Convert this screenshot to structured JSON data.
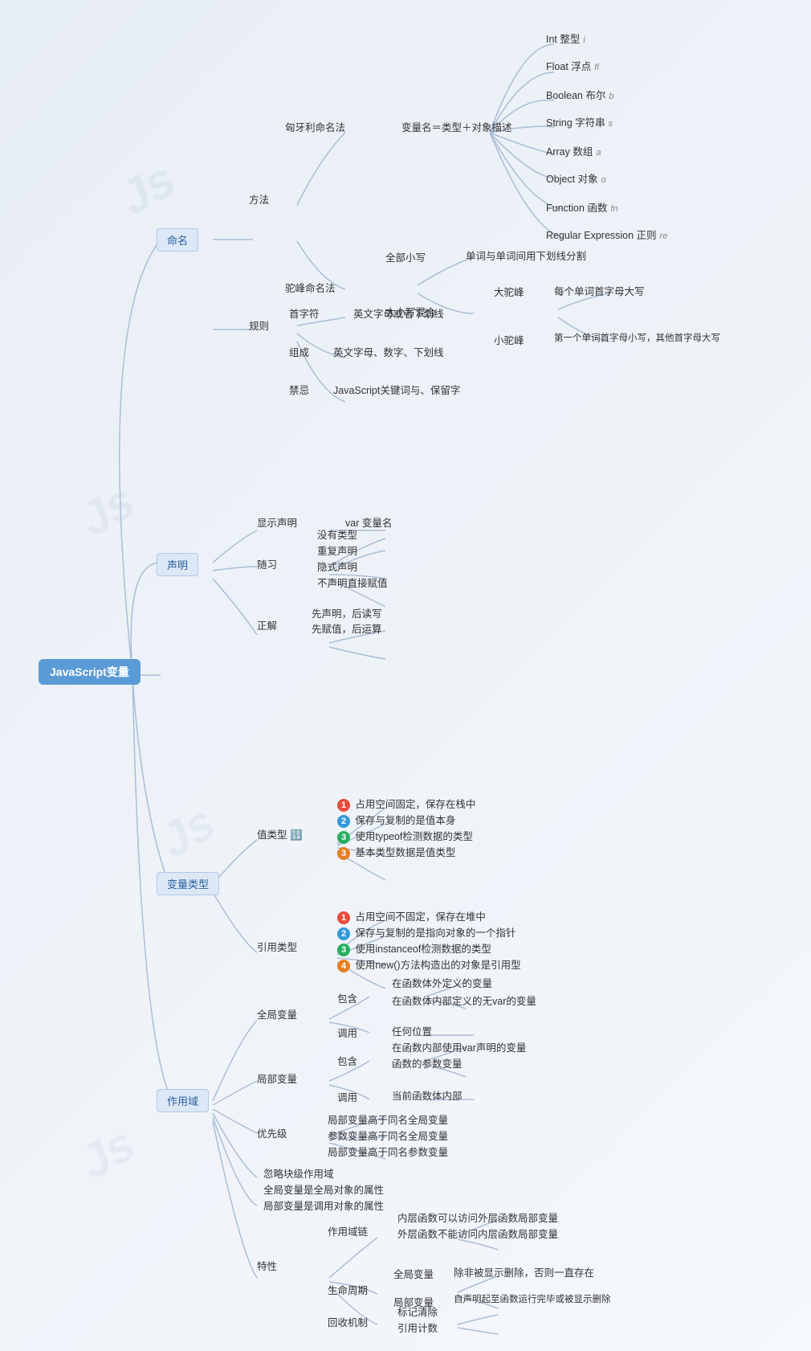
{
  "root": {
    "label": "JavaScript变量"
  },
  "sections": {
    "naming": {
      "label": "命名",
      "sub": {
        "method": {
          "label": "方法",
          "items": [
            {
              "label": "匈牙利命名法",
              "detail": "变量名＝类型＋对象描述",
              "types": [
                {
                  "name": "Int 整型",
                  "abbr": "i"
                },
                {
                  "name": "Float 浮点",
                  "abbr": "fl"
                },
                {
                  "name": "Boolean 布尔",
                  "abbr": "b"
                },
                {
                  "name": "String 字符串",
                  "abbr": "s"
                },
                {
                  "name": "Array 数组",
                  "abbr": "a"
                },
                {
                  "name": "Object 对象",
                  "abbr": "o"
                },
                {
                  "name": "Function 函数",
                  "abbr": "fn"
                },
                {
                  "name": "Regular Expression 正则",
                  "abbr": "re"
                }
              ]
            },
            {
              "label": "驼峰命名法",
              "items": [
                {
                  "label": "全部小写",
                  "detail": "单词与单词间用下划线分割"
                },
                {
                  "label": "大小写混合",
                  "items": [
                    {
                      "label": "大驼峰",
                      "detail": "每个单词首字母大写"
                    },
                    {
                      "label": "小驼峰",
                      "detail": "第一个单词首字母小写，其他首字母大写"
                    }
                  ]
                }
              ]
            }
          ]
        },
        "rules": {
          "label": "规则",
          "items": [
            {
              "label": "首字符",
              "detail": "英文字母或者下划线"
            },
            {
              "label": "组成",
              "detail": "英文字母、数字、下划线"
            },
            {
              "label": "禁忌",
              "detail": "JavaScript关键词与、保留字"
            }
          ]
        }
      }
    },
    "declaration": {
      "label": "声明",
      "sub": {
        "explicit": {
          "label": "显示声明",
          "detail": "var 变量名"
        },
        "implicit": {
          "label": "随习",
          "items": [
            {
              "text": "没有类型"
            },
            {
              "text": "重复声明"
            },
            {
              "text": "隐式声明"
            },
            {
              "text": "不声明直接赋值"
            }
          ]
        },
        "correct": {
          "label": "正解",
          "items": [
            {
              "text": "先声明，后读写"
            },
            {
              "text": "先赋值，后运算"
            }
          ]
        }
      }
    },
    "vartype": {
      "label": "变量类型",
      "sub": {
        "value": {
          "label": "值类型 🔢",
          "items": [
            {
              "badge": "red",
              "num": "1",
              "text": "占用空间固定，保存在栈中"
            },
            {
              "badge": "blue",
              "num": "2",
              "text": "保存与复制的是值本身"
            },
            {
              "badge": "green",
              "num": "3",
              "text": "使用typeof检测数据的类型"
            },
            {
              "badge": "orange",
              "num": "3",
              "text": "基本类型数据是值类型"
            }
          ]
        },
        "reference": {
          "label": "引用类型",
          "items": [
            {
              "badge": "red",
              "num": "1",
              "text": "占用空间不固定，保存在堆中"
            },
            {
              "badge": "blue",
              "num": "2",
              "text": "保存与复制的是指向对象的一个指针"
            },
            {
              "badge": "green",
              "num": "3",
              "text": "使用instanceof检测数据的类型"
            },
            {
              "badge": "orange",
              "num": "4",
              "text": "使用new()方法构造出的对象是引用型"
            }
          ]
        }
      }
    },
    "scope": {
      "label": "作用域",
      "sub": {
        "global": {
          "label": "全局变量",
          "items": [
            {
              "label": "包含",
              "items": [
                {
                  "text": "在函数体外定义的变量"
                },
                {
                  "text": "在函数体内部定义的无var的变量"
                }
              ]
            },
            {
              "label": "调用",
              "detail": "任何位置"
            }
          ]
        },
        "local": {
          "label": "局部变量",
          "items": [
            {
              "label": "包含",
              "items": [
                {
                  "text": "在函数内部使用var声明的变量"
                },
                {
                  "text": "函数的参数变量"
                }
              ]
            },
            {
              "label": "调用",
              "detail": "当前函数体内部"
            }
          ]
        },
        "priority": {
          "label": "优先级",
          "items": [
            {
              "text": "局部变量高于同名全局变量"
            },
            {
              "text": "参数变量高于同名全局变量"
            },
            {
              "text": "局部变量高于同名参数变量"
            }
          ]
        },
        "extra": [
          {
            "text": "忽略块级作用域"
          },
          {
            "text": "全局变量是全局对象的属性"
          },
          {
            "text": "局部变量是调用对象的属性"
          }
        ],
        "special": {
          "label": "特性",
          "items": [
            {
              "label": "作用域链",
              "items": [
                {
                  "text": "内层函数可以访问外层函数局部变量"
                },
                {
                  "text": "外层函数不能访问内层函数局部变量"
                }
              ]
            },
            {
              "label": "生命周期",
              "items": [
                {
                  "label": "全局变量",
                  "detail": "除非被显示删除，否则一直存在"
                },
                {
                  "label": "局部变量",
                  "detail": "自声明起至函数运行完毕或被显示删除"
                }
              ]
            },
            {
              "label": "回收机制",
              "items": [
                {
                  "text": "标记清除"
                },
                {
                  "text": "引用计数"
                }
              ]
            }
          ]
        }
      }
    }
  }
}
